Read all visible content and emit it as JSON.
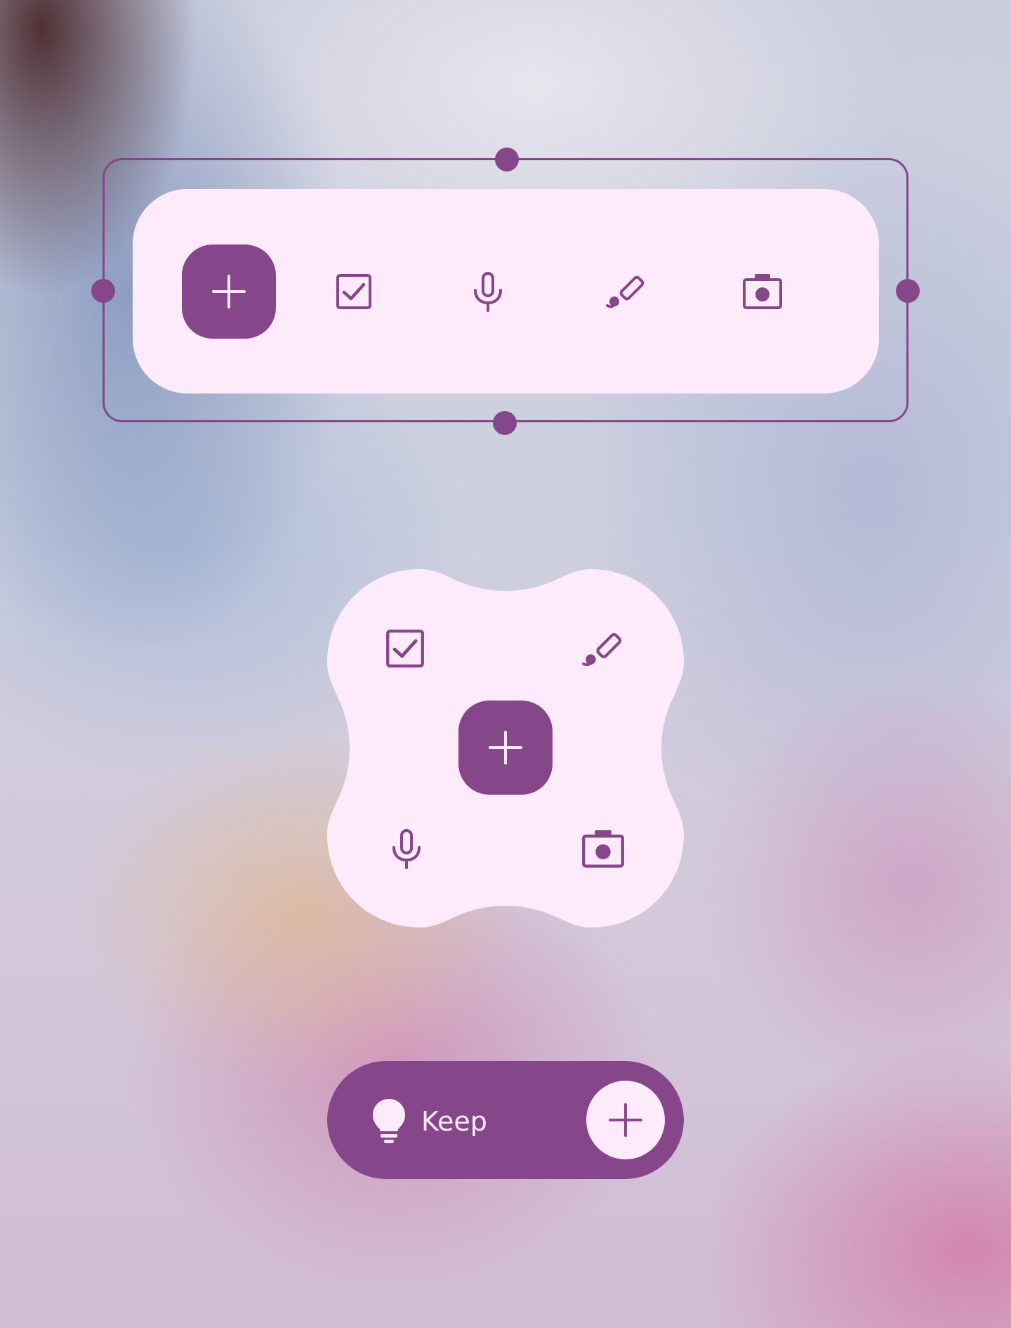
{
  "theme": {
    "accent": "#86468a",
    "surface": "#fdebfb"
  },
  "horizontal_toolbar": {
    "primary": {
      "icon": "plus-icon"
    },
    "actions": [
      {
        "icon": "checkbox-icon"
      },
      {
        "icon": "microphone-icon"
      },
      {
        "icon": "brush-icon"
      },
      {
        "icon": "camera-icon"
      }
    ],
    "selection_handles": [
      "top",
      "right",
      "bottom",
      "left"
    ]
  },
  "cluster_widget": {
    "primary": {
      "icon": "plus-icon"
    },
    "actions": [
      {
        "icon": "checkbox-icon"
      },
      {
        "icon": "brush-icon"
      },
      {
        "icon": "microphone-icon"
      },
      {
        "icon": "camera-icon"
      }
    ]
  },
  "pill_widget": {
    "app_icon": "lightbulb-icon",
    "label": "Keep",
    "action_icon": "plus-icon"
  }
}
